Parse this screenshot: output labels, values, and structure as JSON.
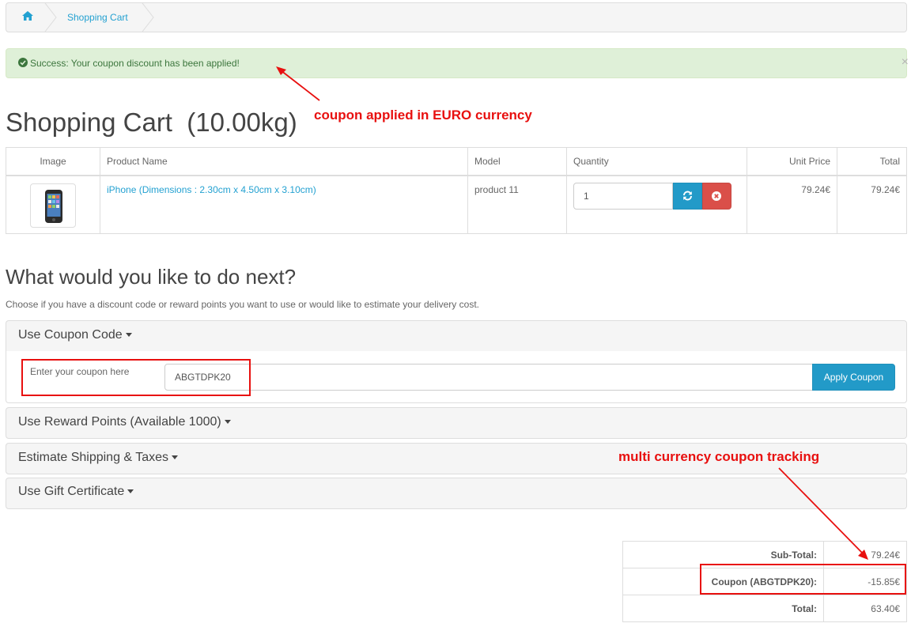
{
  "breadcrumb": {
    "home_icon": "home-icon",
    "items": [
      "Shopping Cart"
    ]
  },
  "alert": {
    "icon": "check-circle-icon",
    "message": "Success: Your coupon discount has been applied!",
    "close": "×"
  },
  "page": {
    "title": "Shopping Cart  (10.00kg)"
  },
  "cart": {
    "columns": [
      "Image",
      "Product Name",
      "Model",
      "Quantity",
      "Unit Price",
      "Total"
    ],
    "rows": [
      {
        "image_icon": "phone-icon",
        "product": "iPhone (Dimensions : 2.30cm x 4.50cm x 3.10cm)",
        "model": "product 11",
        "quantity": "1",
        "update_icon": "refresh-icon",
        "remove_icon": "remove-circle-icon",
        "unit_price": "79.24€",
        "total": "79.24€"
      }
    ]
  },
  "next": {
    "heading": "What would you like to do next?",
    "description": "Choose if you have a discount code or reward points you want to use or would like to estimate your delivery cost.",
    "panels": {
      "coupon": "Use Coupon Code",
      "reward": "Use Reward Points (Available 1000)",
      "shipping": "Estimate Shipping & Taxes",
      "gift": "Use Gift Certificate"
    },
    "coupon_label": "Enter your coupon here",
    "coupon_value": "ABGTDPK20",
    "apply_button": "Apply Coupon"
  },
  "totals": [
    {
      "label": "Sub-Total:",
      "value": "79.24€"
    },
    {
      "label": "Coupon (ABGTDPK20):",
      "value": "-15.85€"
    },
    {
      "label": "Total:",
      "value": "63.40€"
    }
  ],
  "annotations": {
    "euro_note": "coupon applied in EURO currency",
    "tracking_note": "multi currency coupon tracking",
    "color": "#e8100f"
  },
  "colors": {
    "accent": "#229ac8",
    "danger": "#da4f49",
    "success_bg": "#dff0d8",
    "success_text": "#3c763d"
  }
}
